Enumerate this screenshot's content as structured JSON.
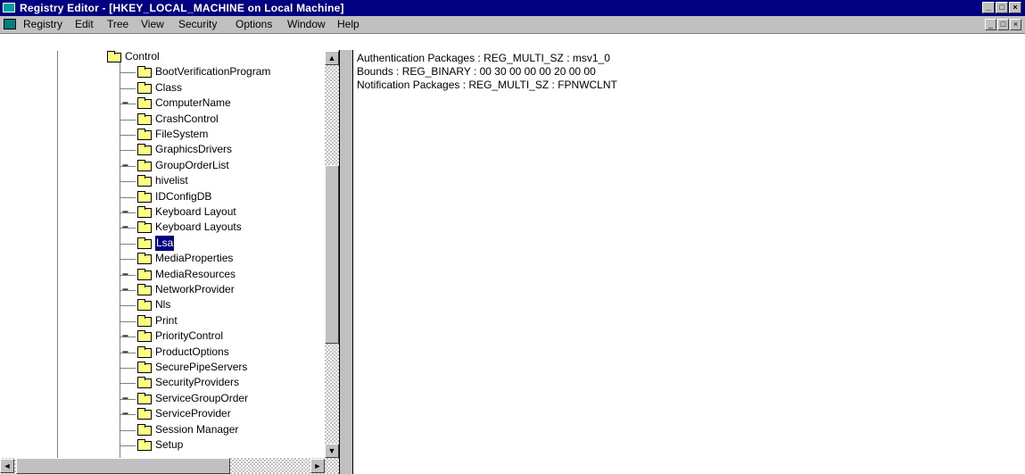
{
  "window": {
    "title": "Registry Editor - [HKEY_LOCAL_MACHINE on Local Machine]",
    "controls": [
      "_",
      "□",
      "×"
    ]
  },
  "menubar": {
    "items": [
      "Registry",
      "Edit",
      "Tree",
      "View",
      "Security",
      "Options",
      "Window",
      "Help"
    ],
    "mdi_controls": [
      "_",
      "□",
      "×"
    ]
  },
  "tree": {
    "items": [
      {
        "label": "Control",
        "state": "open",
        "indent": 0
      },
      {
        "label": "BootVerificationProgram",
        "indent": 1
      },
      {
        "label": "Class",
        "indent": 1
      },
      {
        "label": "ComputerName",
        "indent": 1,
        "expander": "−"
      },
      {
        "label": "CrashControl",
        "indent": 1
      },
      {
        "label": "FileSystem",
        "indent": 1
      },
      {
        "label": "GraphicsDrivers",
        "indent": 1
      },
      {
        "label": "GroupOrderList",
        "indent": 1,
        "expander": "−"
      },
      {
        "label": "hivelist",
        "indent": 1
      },
      {
        "label": "IDConfigDB",
        "indent": 1
      },
      {
        "label": "Keyboard Layout",
        "indent": 1,
        "expander": "−"
      },
      {
        "label": "Keyboard Layouts",
        "indent": 1,
        "expander": "−"
      },
      {
        "label": "Lsa",
        "indent": 1,
        "selected": true
      },
      {
        "label": "MediaProperties",
        "indent": 1
      },
      {
        "label": "MediaResources",
        "indent": 1,
        "expander": "−"
      },
      {
        "label": "NetworkProvider",
        "indent": 1,
        "expander": "−"
      },
      {
        "label": "Nls",
        "indent": 1
      },
      {
        "label": "Print",
        "indent": 1
      },
      {
        "label": "PriorityControl",
        "indent": 1,
        "expander": "−"
      },
      {
        "label": "ProductOptions",
        "indent": 1,
        "expander": "−"
      },
      {
        "label": "SecurePipeServers",
        "indent": 1
      },
      {
        "label": "SecurityProviders",
        "indent": 1
      },
      {
        "label": "ServiceGroupOrder",
        "indent": 1,
        "expander": "−"
      },
      {
        "label": "ServiceProvider",
        "indent": 1,
        "expander": "−"
      },
      {
        "label": "Session Manager",
        "indent": 1
      },
      {
        "label": "Setup",
        "indent": 1
      }
    ]
  },
  "values_pane": {
    "rows": [
      "Authentication Packages : REG_MULTI_SZ : msv1_0",
      "Bounds : REG_BINARY : 00 30 00 00 00 20 00 00",
      "Notification Packages : REG_MULTI_SZ : FPNWCLNT"
    ]
  },
  "scrollbars": {
    "up": "▲",
    "down": "▼",
    "left": "◄",
    "right": "►"
  },
  "colors": {
    "titlebar": "#000080",
    "selection": "#000080",
    "chrome": "#c0c0c0",
    "folder": "#ffff80"
  }
}
